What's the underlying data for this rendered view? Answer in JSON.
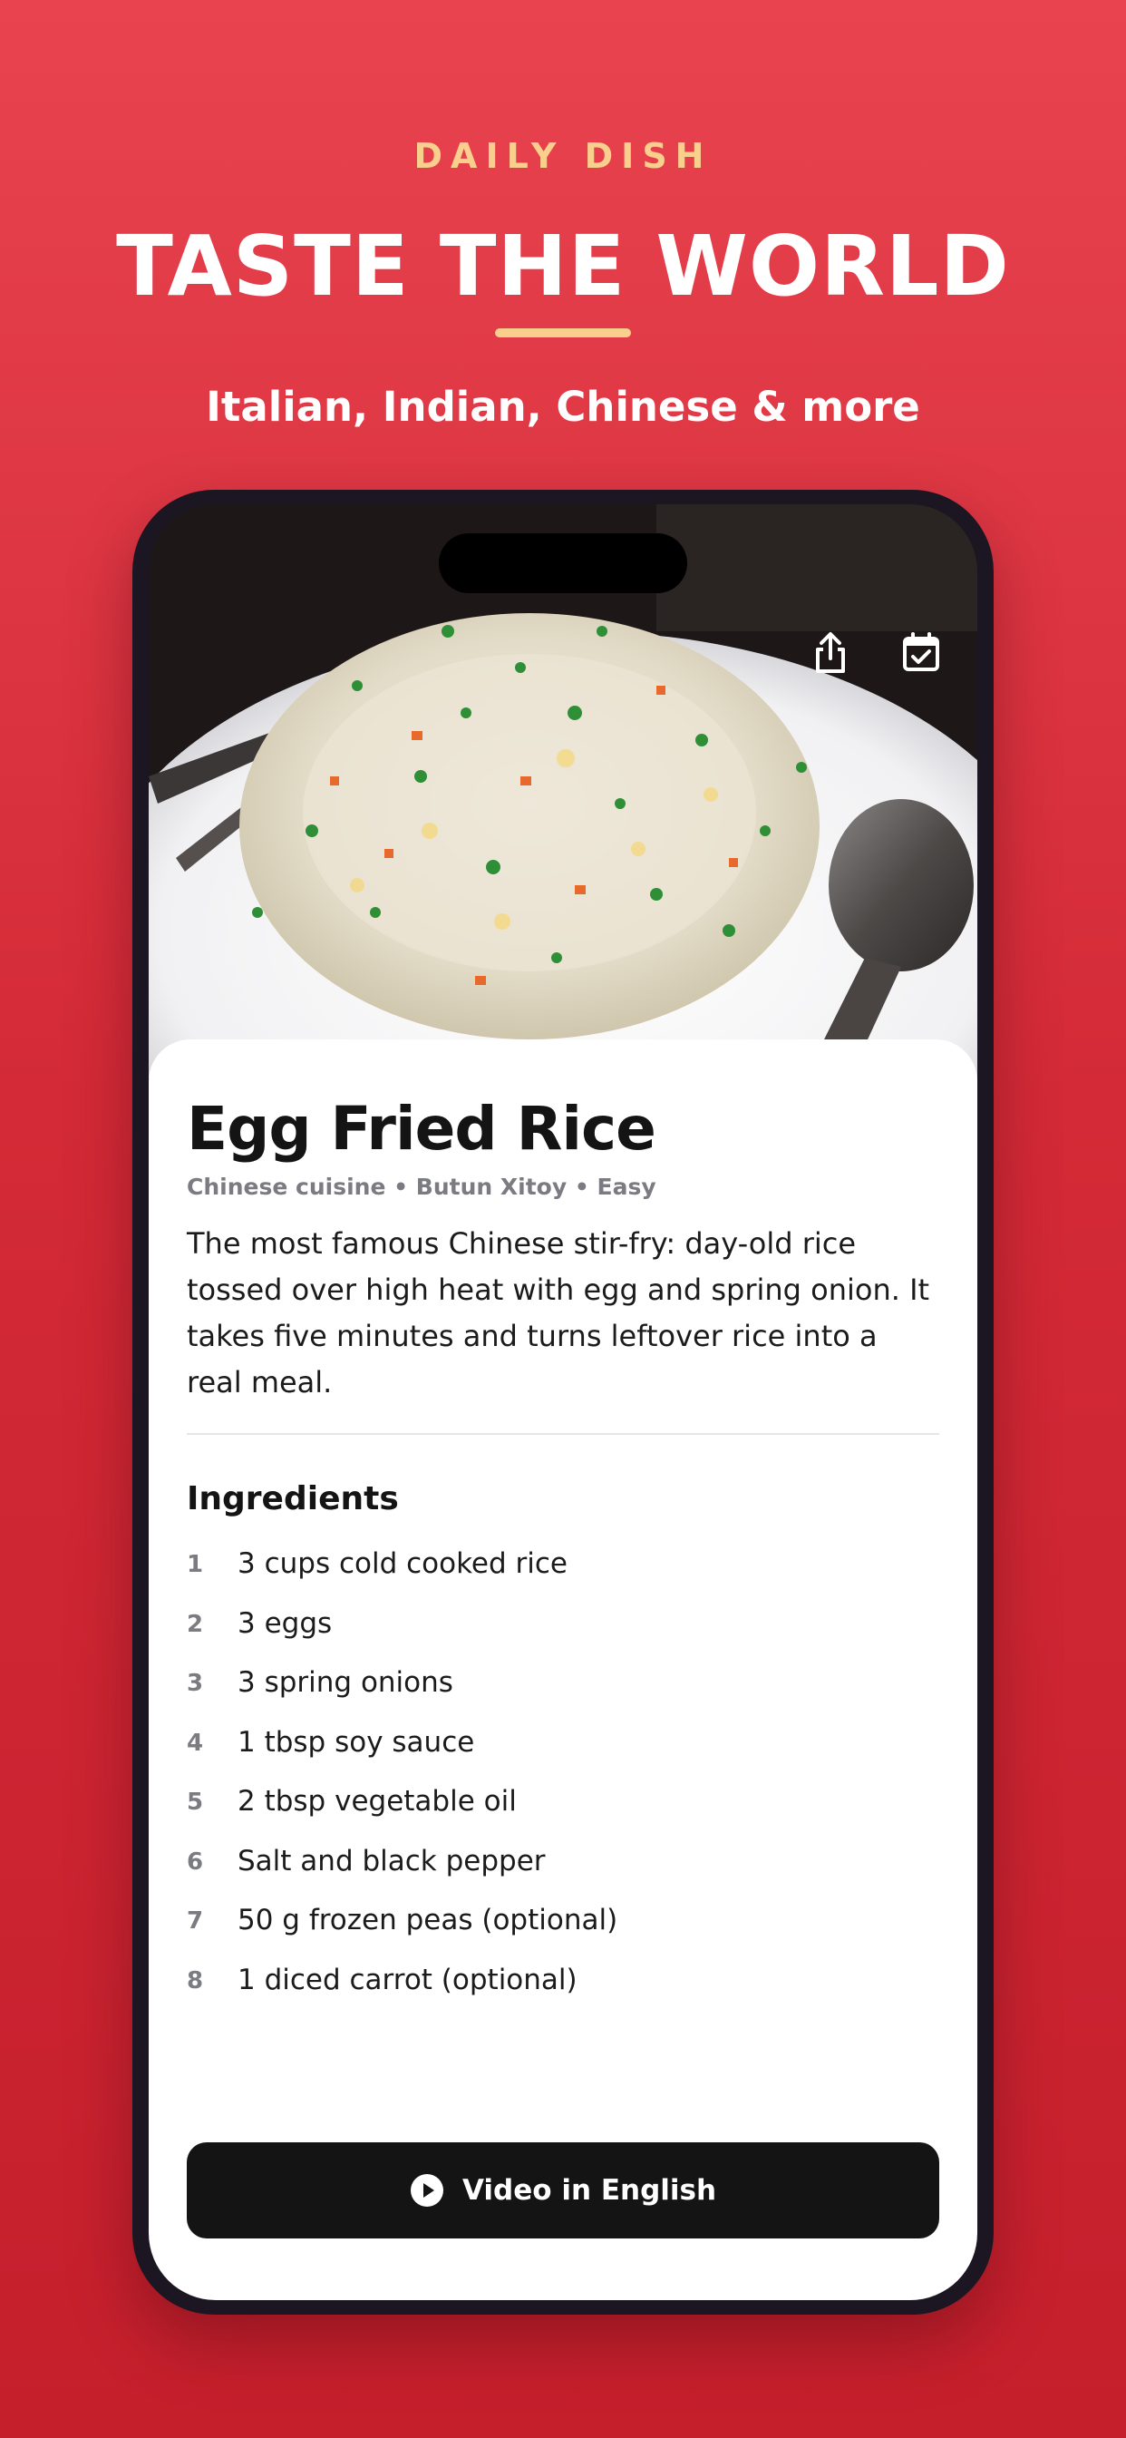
{
  "promo": {
    "eyebrow": "DAILY DISH",
    "title": "TASTE THE WORLD",
    "subtitle": "Italian, Indian, Chinese & more"
  },
  "hero": {
    "share_icon": "share-icon",
    "calendar_icon": "calendar-check-icon"
  },
  "recipe": {
    "title": "Egg Fried Rice",
    "meta": "Chinese cuisine • Butun Xitoy • Easy",
    "description": "The most famous Chinese stir-fry: day-old rice tossed over high heat with egg and spring onion. It takes five minutes and turns leftover rice into a real meal.",
    "ingredients_heading": "Ingredients",
    "ingredients": [
      {
        "num": "1",
        "text": "3 cups cold cooked rice"
      },
      {
        "num": "2",
        "text": "3 eggs"
      },
      {
        "num": "3",
        "text": "3 spring onions"
      },
      {
        "num": "4",
        "text": "1 tbsp soy sauce"
      },
      {
        "num": "5",
        "text": "2 tbsp vegetable oil"
      },
      {
        "num": "6",
        "text": "Salt and black pepper"
      },
      {
        "num": "7",
        "text": "50 g frozen peas (optional)"
      },
      {
        "num": "8",
        "text": "1 diced carrot (optional)"
      }
    ],
    "video_button_label": "Video in English",
    "video_icon": "play-circle-icon"
  },
  "colors": {
    "background": "#d42a37",
    "accent": "#f9cf8e",
    "button": "#141414"
  }
}
